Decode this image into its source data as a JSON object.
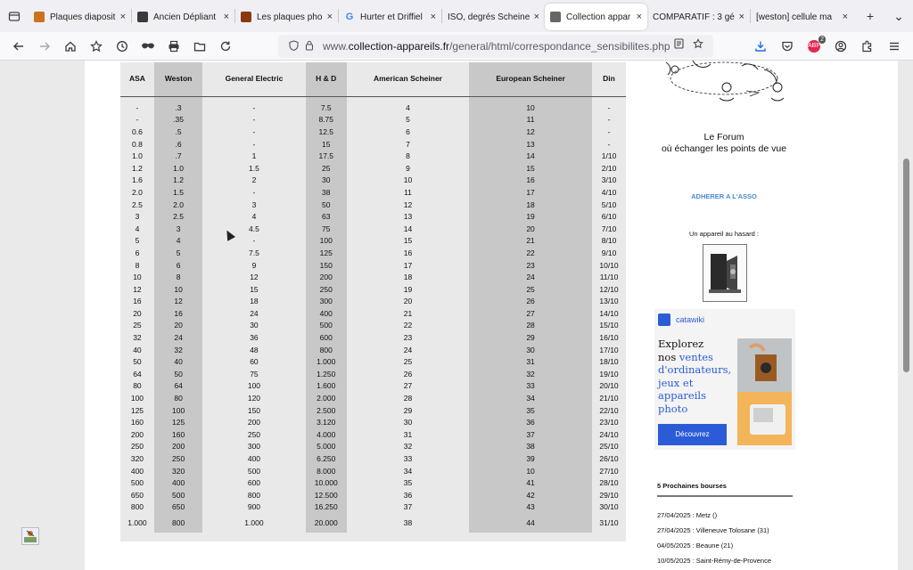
{
  "tabs": [
    {
      "label": "Plaques diaposit",
      "fav_color": "#c9721f",
      "active": false
    },
    {
      "label": "Ancien Dépliant",
      "fav_color": "#3a3a3a",
      "active": false
    },
    {
      "label": "Les plaques pho",
      "fav_color": "#8a3a12",
      "active": false
    },
    {
      "label": "Hurter et Driffiel",
      "fav_color": "#4285f4",
      "fav_glyph": "G",
      "active": false
    },
    {
      "label": "ISO, degrés Scheine",
      "fav_color": "",
      "active": false
    },
    {
      "label": "Collection appar",
      "fav_color": "#666666",
      "active": true
    },
    {
      "label": "COMPARATIF : 3 gé",
      "fav_color": "",
      "active": false
    },
    {
      "label": "[weston] cellule ma",
      "fav_color": "",
      "active": false
    }
  ],
  "tab_close_glyph": "×",
  "new_tab_glyph": "+",
  "tabs_menu_glyph": "⌄",
  "url": {
    "prefix": "www.",
    "domain": "collection-appareils.fr",
    "path": "/general/html/correspondance_sensibilites.php"
  },
  "ext_badge_count": "2",
  "table": {
    "headers": [
      "ASA",
      "Weston",
      "General Electric",
      "H & D",
      "American Scheiner",
      "European Scheiner",
      "Din"
    ],
    "rows": [
      [
        "-",
        ".3",
        "-",
        "7.5",
        "4",
        "10",
        "-"
      ],
      [
        "-",
        ".35",
        "-",
        "8.75",
        "5",
        "11",
        "-"
      ],
      [
        "0.6",
        ".5",
        "-",
        "12.5",
        "6",
        "12",
        "-"
      ],
      [
        "0.8",
        ".6",
        "-",
        "15",
        "7",
        "13",
        "-"
      ],
      [
        "1.0",
        ".7",
        "1",
        "17.5",
        "8",
        "14",
        "1/10"
      ],
      [
        "1.2",
        "1.0",
        "1.5",
        "25",
        "9",
        "15",
        "2/10"
      ],
      [
        "1.6",
        "1.2",
        "2",
        "30",
        "10",
        "16",
        "3/10"
      ],
      [
        "2.0",
        "1.5",
        "-",
        "38",
        "11",
        "17",
        "4/10"
      ],
      [
        "2.5",
        "2.0",
        "3",
        "50",
        "12",
        "18",
        "5/10"
      ],
      [
        "3",
        "2.5",
        "4",
        "63",
        "13",
        "19",
        "6/10"
      ],
      [
        "4",
        "3",
        "4.5",
        "75",
        "14",
        "20",
        "7/10"
      ],
      [
        "5",
        "4",
        "-",
        "100",
        "15",
        "21",
        "8/10"
      ],
      [
        "6",
        "5",
        "7.5",
        "125",
        "16",
        "22",
        "9/10"
      ],
      [
        "8",
        "6",
        "9",
        "150",
        "17",
        "23",
        "10/10"
      ],
      [
        "10",
        "8",
        "12",
        "200",
        "18",
        "24",
        "11/10"
      ],
      [
        "12",
        "10",
        "15",
        "250",
        "19",
        "25",
        "12/10"
      ],
      [
        "16",
        "12",
        "18",
        "300",
        "20",
        "26",
        "13/10"
      ],
      [
        "20",
        "16",
        "24",
        "400",
        "21",
        "27",
        "14/10"
      ],
      [
        "25",
        "20",
        "30",
        "500",
        "22",
        "28",
        "15/10"
      ],
      [
        "32",
        "24",
        "36",
        "600",
        "23",
        "29",
        "16/10"
      ],
      [
        "40",
        "32",
        "48",
        "800",
        "24",
        "30",
        "17/10"
      ],
      [
        "50",
        "40",
        "60",
        "1.000",
        "25",
        "31",
        "18/10"
      ],
      [
        "64",
        "50",
        "75",
        "1.250",
        "26",
        "32",
        "19/10"
      ],
      [
        "80",
        "64",
        "100",
        "1.600",
        "27",
        "33",
        "20/10"
      ],
      [
        "100",
        "80",
        "120",
        "2.000",
        "28",
        "34",
        "21/10"
      ],
      [
        "125",
        "100",
        "150",
        "2.500",
        "29",
        "35",
        "22/10"
      ],
      [
        "160",
        "125",
        "200",
        "3.120",
        "30",
        "36",
        "23/10"
      ],
      [
        "200",
        "160",
        "250",
        "4.000",
        "31",
        "37",
        "24/10"
      ],
      [
        "250",
        "200",
        "300",
        "5.000",
        "32",
        "38",
        "25/10"
      ],
      [
        "320",
        "250",
        "400",
        "6.250",
        "33",
        "39",
        "26/10"
      ],
      [
        "400",
        "320",
        "500",
        "8.000",
        "34",
        "10",
        "27/10"
      ],
      [
        "500",
        "400",
        "600",
        "10.000",
        "35",
        "41",
        "28/10"
      ],
      [
        "650",
        "500",
        "800",
        "12.500",
        "36",
        "42",
        "29/10"
      ],
      [
        "800",
        "650",
        "900",
        "16.250",
        "37",
        "43",
        "30/10"
      ],
      [
        "1.000",
        "800",
        "1.000",
        "20.000",
        "38",
        "44",
        "31/10"
      ]
    ]
  },
  "sidebar": {
    "forum_title": "Le Forum",
    "forum_subtitle": "où échanger les points de vue",
    "adherer": "ADHERER A L'ASSO",
    "random_label": "Un appareil au hasard :",
    "ad": {
      "brand": "catawiki",
      "line1": "Explorez",
      "line2_plain": "nos ",
      "line2_hl": "ventes",
      "line3_hl": "d'ordinateurs,",
      "line4_hl": "jeux et",
      "line5_hl": "appareils",
      "line6_hl": "photo",
      "button": "Découvrez",
      "accent": "#2b5bd7"
    },
    "bourses_title": "5 Prochaines bourses",
    "bourses": [
      "27/04/2025 : Metz ()",
      "27/04/2025 : Villeneuve Tolosane (31)",
      "04/05/2025 : Beaune (21)",
      "10/05/2025 : Saint-Rémy-de-Provence"
    ]
  }
}
